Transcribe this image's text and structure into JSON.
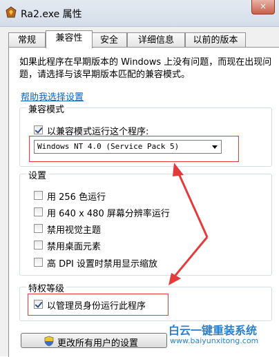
{
  "window": {
    "title": "Ra2.exe 属性",
    "close_glyph": "×"
  },
  "tabs": [
    {
      "label": "常规",
      "active": false
    },
    {
      "label": "兼容性",
      "active": true
    },
    {
      "label": "安全",
      "active": false
    },
    {
      "label": "详细信息",
      "active": false
    },
    {
      "label": "以前的版本",
      "active": false
    }
  ],
  "description": "如果此程序在早期版本的 Windows 上没有问题，而现在出现问题，请选择与该早期版本匹配的兼容模式。",
  "help_link": "帮助我选择设置",
  "compat_mode": {
    "group_title": "兼容模式",
    "checkbox_label": "以兼容模式运行这个程序:",
    "checked": true,
    "selected_value": "Windows NT 4.0 (Service Pack 5)"
  },
  "settings": {
    "group_title": "设置",
    "items": [
      {
        "label": "用 256 色运行",
        "checked": false
      },
      {
        "label": "用 640 x 480 屏幕分辨率运行",
        "checked": false
      },
      {
        "label": "禁用视觉主题",
        "checked": false
      },
      {
        "label": "禁用桌面元素",
        "checked": false
      },
      {
        "label": "高 DPI 设置时禁用显示缩放",
        "checked": false
      }
    ]
  },
  "privilege": {
    "group_title": "特权等级",
    "checkbox_label": "以管理员身份运行此程序",
    "checked": true
  },
  "all_users_button": "更改所有用户的设置",
  "watermark": {
    "brand": "白云一键重装系统",
    "url": "www.baiyunxitong.com"
  },
  "colors": {
    "annotation_red": "#e53a3a",
    "link_blue": "#0a62b9",
    "watermark_blue": "#2b7fc8"
  }
}
